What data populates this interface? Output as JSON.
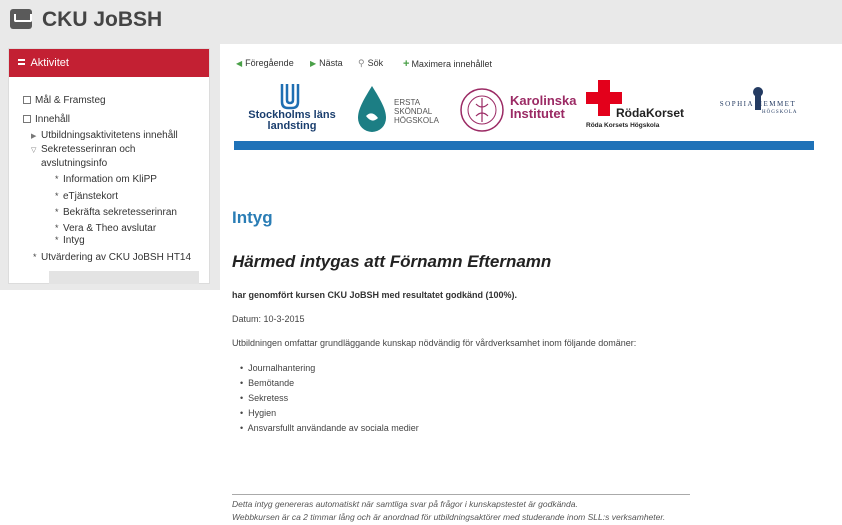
{
  "app": {
    "title": "CKU JoBSH"
  },
  "sidebar": {
    "header": "Aktivitet",
    "items": [
      {
        "label": "Mål & Framsteg"
      },
      {
        "label": "Innehåll"
      },
      {
        "label": "Utbildningsaktivitetens innehåll"
      },
      {
        "label_line1": "Sekretesserinran och",
        "label_line2": "avslutningsinfo"
      },
      {
        "label": "Information om KliPP"
      },
      {
        "label": "eTjänstekort"
      },
      {
        "label": "Bekräfta sekretesserinran"
      },
      {
        "label": "Vera & Theo avslutar"
      },
      {
        "label": "Intyg"
      },
      {
        "label": "Utvärdering av CKU JoBSH HT14"
      }
    ]
  },
  "toolbar": {
    "prev": "Föregående",
    "next": "Nästa",
    "search": "Sök",
    "maximize": "Maximera innehållet"
  },
  "logos": {
    "sll_line1": "Stockholms läns",
    "sll_line2": "landsting",
    "ersta_line1": "ERSTA",
    "ersta_line2": "SKÖNDAL",
    "ersta_line3": "HÖGSKOLA",
    "ki_line1": "Karolinska",
    "ki_line2": "Institutet",
    "rk_line1": "RödaKorset",
    "rk_line2": "Röda Korsets Högskola",
    "sophia_line1": "SOPHIA HEMMET",
    "sophia_line2": "HÖGSKOLA"
  },
  "certificate": {
    "title": "Intyg",
    "heading": "Härmed intygas att Förnamn Efternamn",
    "completed": "har genomfört kursen CKU JoBSH med resultatet godkänd (100%).",
    "date": "Datum: 10-3-2015",
    "intro": "Utbildningen omfattar grundläggande kunskap nödvändig för vårdverksamhet inom följande domäner:",
    "domains": [
      "Journalhantering",
      "Bemötande",
      "Sekretess",
      "Hygien",
      "Ansvarsfullt användande av sociala medier"
    ],
    "footer1": "Detta intyg genereras automatiskt när samtliga svar på frågor i kunskapstestet är godkända.",
    "footer2": "Webbkursen är ca 2 timmar lång och är anordnad för utbildningsaktörer med studerande inom SLL:s verksamheter."
  },
  "colors": {
    "accent_red": "#c32033",
    "link_blue": "#2a7db5",
    "rule_blue": "#1f72b8",
    "toolbar_green": "#4aa048"
  }
}
